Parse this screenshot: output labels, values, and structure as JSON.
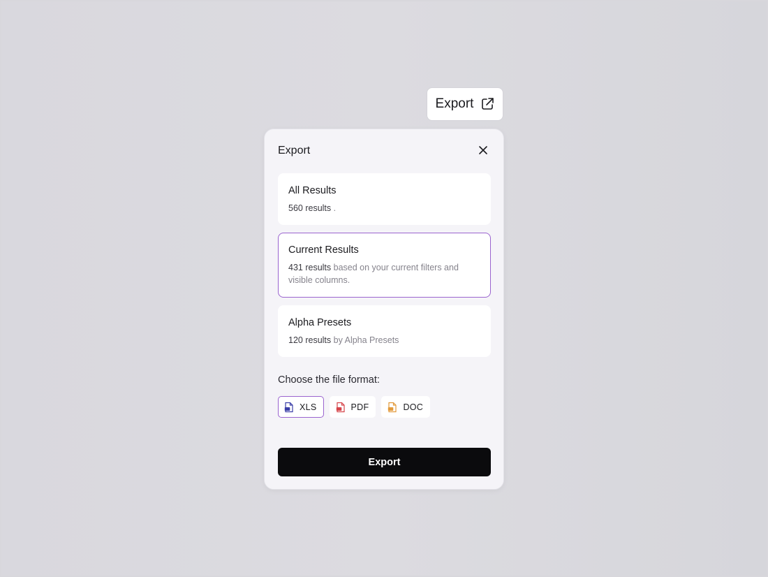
{
  "trigger": {
    "label": "Export",
    "icon": "external-link-icon"
  },
  "dialog": {
    "title": "Export",
    "close_icon": "close-icon",
    "options": [
      {
        "title": "All Results",
        "count": "560 results",
        "detail": " ."
      },
      {
        "title": "Current Results",
        "count": "431 results",
        "detail": " based on your current filters and visible columns.",
        "selected": true
      },
      {
        "title": "Alpha Presets",
        "count": "120 results",
        "detail": " by Alpha Presets"
      }
    ],
    "format_label": "Choose the file format:",
    "formats": [
      {
        "label": "XLS",
        "icon": "xls-file-icon",
        "selected": true
      },
      {
        "label": "PDF",
        "icon": "pdf-file-icon"
      },
      {
        "label": "DOC",
        "icon": "doc-file-icon"
      }
    ],
    "export_button": "Export"
  },
  "colors": {
    "accent": "#9a63cf",
    "xls_icon": "#3b3fa8",
    "pdf_icon": "#d6454b",
    "doc_icon": "#e29a3b",
    "button_bg": "#0b0b0d",
    "background": "#d9d8de"
  }
}
